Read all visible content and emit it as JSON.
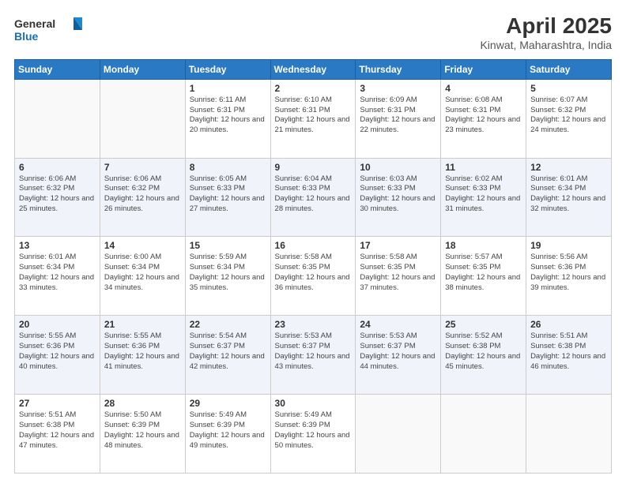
{
  "header": {
    "logo_line1": "General",
    "logo_line2": "Blue",
    "title": "April 2025",
    "subtitle": "Kinwat, Maharashtra, India"
  },
  "weekdays": [
    "Sunday",
    "Monday",
    "Tuesday",
    "Wednesday",
    "Thursday",
    "Friday",
    "Saturday"
  ],
  "weeks": [
    [
      {
        "day": "",
        "sunrise": "",
        "sunset": "",
        "daylight": ""
      },
      {
        "day": "",
        "sunrise": "",
        "sunset": "",
        "daylight": ""
      },
      {
        "day": "1",
        "sunrise": "Sunrise: 6:11 AM",
        "sunset": "Sunset: 6:31 PM",
        "daylight": "Daylight: 12 hours and 20 minutes."
      },
      {
        "day": "2",
        "sunrise": "Sunrise: 6:10 AM",
        "sunset": "Sunset: 6:31 PM",
        "daylight": "Daylight: 12 hours and 21 minutes."
      },
      {
        "day": "3",
        "sunrise": "Sunrise: 6:09 AM",
        "sunset": "Sunset: 6:31 PM",
        "daylight": "Daylight: 12 hours and 22 minutes."
      },
      {
        "day": "4",
        "sunrise": "Sunrise: 6:08 AM",
        "sunset": "Sunset: 6:31 PM",
        "daylight": "Daylight: 12 hours and 23 minutes."
      },
      {
        "day": "5",
        "sunrise": "Sunrise: 6:07 AM",
        "sunset": "Sunset: 6:32 PM",
        "daylight": "Daylight: 12 hours and 24 minutes."
      }
    ],
    [
      {
        "day": "6",
        "sunrise": "Sunrise: 6:06 AM",
        "sunset": "Sunset: 6:32 PM",
        "daylight": "Daylight: 12 hours and 25 minutes."
      },
      {
        "day": "7",
        "sunrise": "Sunrise: 6:06 AM",
        "sunset": "Sunset: 6:32 PM",
        "daylight": "Daylight: 12 hours and 26 minutes."
      },
      {
        "day": "8",
        "sunrise": "Sunrise: 6:05 AM",
        "sunset": "Sunset: 6:33 PM",
        "daylight": "Daylight: 12 hours and 27 minutes."
      },
      {
        "day": "9",
        "sunrise": "Sunrise: 6:04 AM",
        "sunset": "Sunset: 6:33 PM",
        "daylight": "Daylight: 12 hours and 28 minutes."
      },
      {
        "day": "10",
        "sunrise": "Sunrise: 6:03 AM",
        "sunset": "Sunset: 6:33 PM",
        "daylight": "Daylight: 12 hours and 30 minutes."
      },
      {
        "day": "11",
        "sunrise": "Sunrise: 6:02 AM",
        "sunset": "Sunset: 6:33 PM",
        "daylight": "Daylight: 12 hours and 31 minutes."
      },
      {
        "day": "12",
        "sunrise": "Sunrise: 6:01 AM",
        "sunset": "Sunset: 6:34 PM",
        "daylight": "Daylight: 12 hours and 32 minutes."
      }
    ],
    [
      {
        "day": "13",
        "sunrise": "Sunrise: 6:01 AM",
        "sunset": "Sunset: 6:34 PM",
        "daylight": "Daylight: 12 hours and 33 minutes."
      },
      {
        "day": "14",
        "sunrise": "Sunrise: 6:00 AM",
        "sunset": "Sunset: 6:34 PM",
        "daylight": "Daylight: 12 hours and 34 minutes."
      },
      {
        "day": "15",
        "sunrise": "Sunrise: 5:59 AM",
        "sunset": "Sunset: 6:34 PM",
        "daylight": "Daylight: 12 hours and 35 minutes."
      },
      {
        "day": "16",
        "sunrise": "Sunrise: 5:58 AM",
        "sunset": "Sunset: 6:35 PM",
        "daylight": "Daylight: 12 hours and 36 minutes."
      },
      {
        "day": "17",
        "sunrise": "Sunrise: 5:58 AM",
        "sunset": "Sunset: 6:35 PM",
        "daylight": "Daylight: 12 hours and 37 minutes."
      },
      {
        "day": "18",
        "sunrise": "Sunrise: 5:57 AM",
        "sunset": "Sunset: 6:35 PM",
        "daylight": "Daylight: 12 hours and 38 minutes."
      },
      {
        "day": "19",
        "sunrise": "Sunrise: 5:56 AM",
        "sunset": "Sunset: 6:36 PM",
        "daylight": "Daylight: 12 hours and 39 minutes."
      }
    ],
    [
      {
        "day": "20",
        "sunrise": "Sunrise: 5:55 AM",
        "sunset": "Sunset: 6:36 PM",
        "daylight": "Daylight: 12 hours and 40 minutes."
      },
      {
        "day": "21",
        "sunrise": "Sunrise: 5:55 AM",
        "sunset": "Sunset: 6:36 PM",
        "daylight": "Daylight: 12 hours and 41 minutes."
      },
      {
        "day": "22",
        "sunrise": "Sunrise: 5:54 AM",
        "sunset": "Sunset: 6:37 PM",
        "daylight": "Daylight: 12 hours and 42 minutes."
      },
      {
        "day": "23",
        "sunrise": "Sunrise: 5:53 AM",
        "sunset": "Sunset: 6:37 PM",
        "daylight": "Daylight: 12 hours and 43 minutes."
      },
      {
        "day": "24",
        "sunrise": "Sunrise: 5:53 AM",
        "sunset": "Sunset: 6:37 PM",
        "daylight": "Daylight: 12 hours and 44 minutes."
      },
      {
        "day": "25",
        "sunrise": "Sunrise: 5:52 AM",
        "sunset": "Sunset: 6:38 PM",
        "daylight": "Daylight: 12 hours and 45 minutes."
      },
      {
        "day": "26",
        "sunrise": "Sunrise: 5:51 AM",
        "sunset": "Sunset: 6:38 PM",
        "daylight": "Daylight: 12 hours and 46 minutes."
      }
    ],
    [
      {
        "day": "27",
        "sunrise": "Sunrise: 5:51 AM",
        "sunset": "Sunset: 6:38 PM",
        "daylight": "Daylight: 12 hours and 47 minutes."
      },
      {
        "day": "28",
        "sunrise": "Sunrise: 5:50 AM",
        "sunset": "Sunset: 6:39 PM",
        "daylight": "Daylight: 12 hours and 48 minutes."
      },
      {
        "day": "29",
        "sunrise": "Sunrise: 5:49 AM",
        "sunset": "Sunset: 6:39 PM",
        "daylight": "Daylight: 12 hours and 49 minutes."
      },
      {
        "day": "30",
        "sunrise": "Sunrise: 5:49 AM",
        "sunset": "Sunset: 6:39 PM",
        "daylight": "Daylight: 12 hours and 50 minutes."
      },
      {
        "day": "",
        "sunrise": "",
        "sunset": "",
        "daylight": ""
      },
      {
        "day": "",
        "sunrise": "",
        "sunset": "",
        "daylight": ""
      },
      {
        "day": "",
        "sunrise": "",
        "sunset": "",
        "daylight": ""
      }
    ]
  ]
}
